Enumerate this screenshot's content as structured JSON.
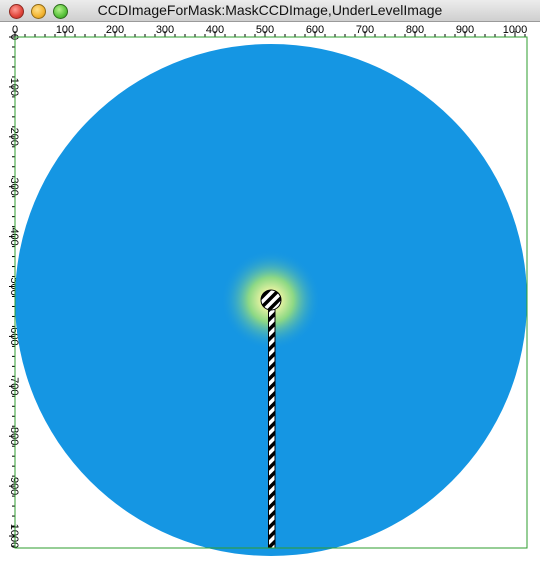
{
  "window": {
    "title": "CCDImageForMask:MaskCCDImage,UnderLevelImage"
  },
  "axes": {
    "x_ticks": [
      "0",
      "100",
      "200",
      "300",
      "400",
      "500",
      "600",
      "700",
      "800",
      "900",
      "1000"
    ],
    "y_ticks": [
      "0",
      "100",
      "200",
      "300",
      "400",
      "500",
      "600",
      "700",
      "800",
      "900",
      "1000"
    ],
    "x_range": [
      0,
      1024
    ],
    "y_range": [
      0,
      1024
    ]
  },
  "colors": {
    "frame": "#2e9d2e",
    "disc": "#1596e3",
    "center_glow": "#f2f28a",
    "mask_fill": "#ffffff",
    "mask_hatch": "#000000"
  },
  "image": {
    "center": [
      512,
      527
    ],
    "radius": 512,
    "beamstop_radius": 20,
    "beamstop_arm_x": [
      507,
      520
    ],
    "beamstop_arm_y": [
      540,
      1024
    ]
  }
}
